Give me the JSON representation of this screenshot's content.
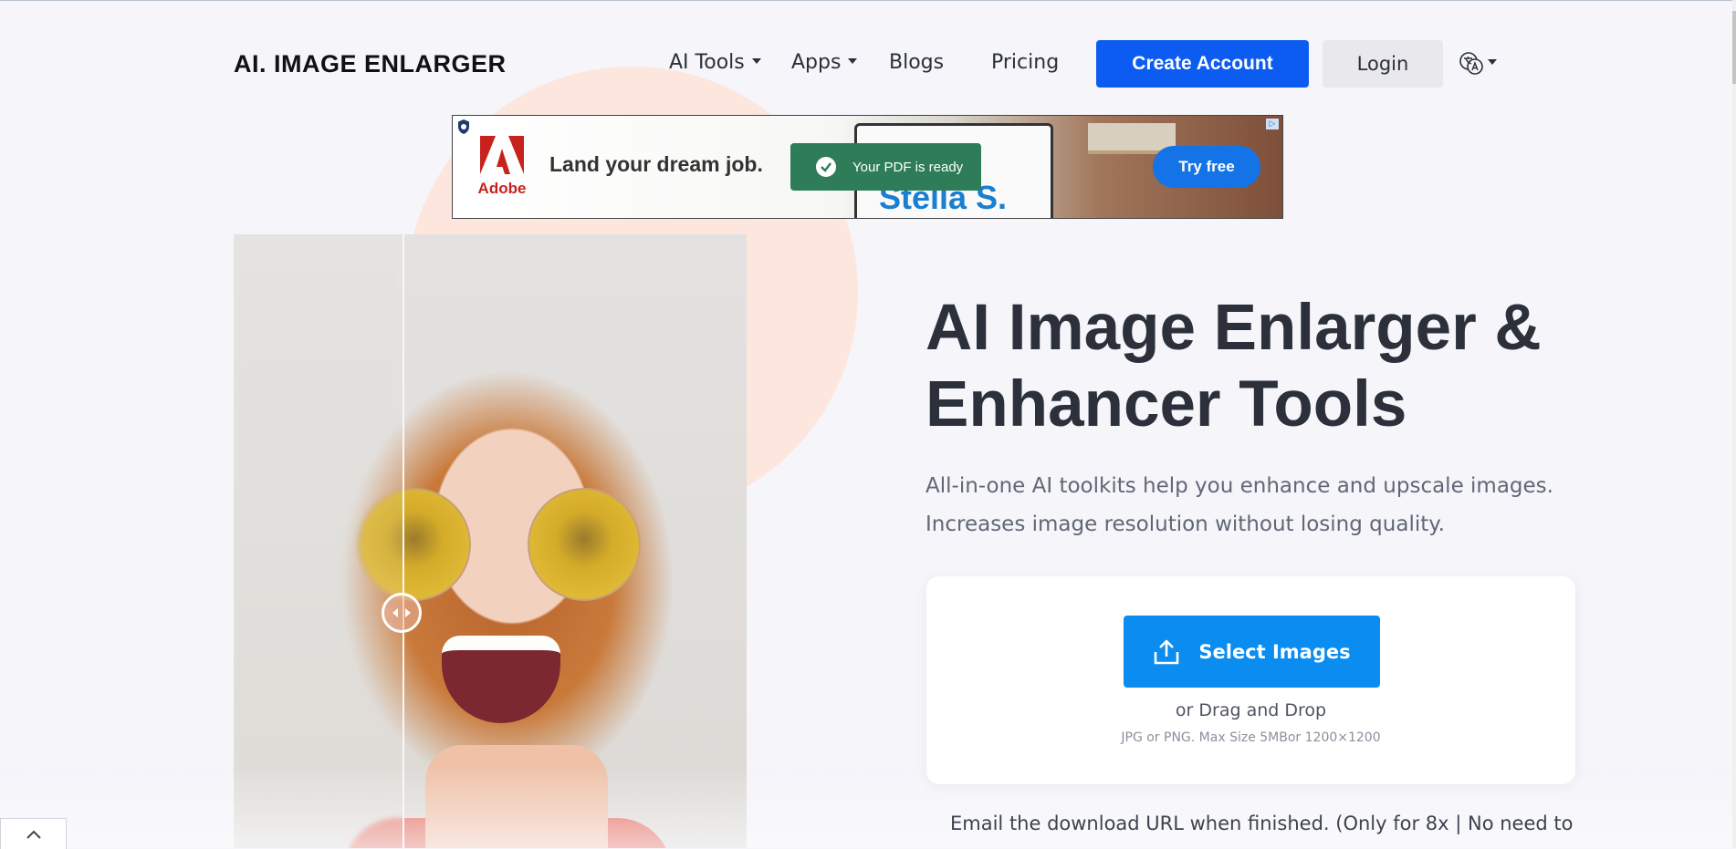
{
  "header": {
    "logo": "AI. IMAGE ENLARGER",
    "nav": [
      {
        "label": "AI Tools"
      },
      {
        "label": "Apps"
      },
      {
        "label": "Blogs"
      },
      {
        "label": "Pricing"
      }
    ],
    "create_account": "Create Account",
    "login": "Login",
    "language_icon": "globe-translate-icon"
  },
  "ad": {
    "brand": "Adobe",
    "headline": "Land your dream job.",
    "toast": "Your PDF is ready",
    "laptop_text": "Stella S.",
    "cta": "Try free"
  },
  "hero": {
    "title": "AI Image Enlarger & Enhancer Tools",
    "subtitle": "All-in-one AI toolkits help you enhance and upscale images. Increases image resolution without losing quality."
  },
  "upload": {
    "button": "Select Images",
    "drag": "or Drag and Drop",
    "hint": "JPG or PNG. Max Size 5MBor 1200×1200"
  },
  "email_note": "Email the download URL when finished. (Only for 8x | No need to",
  "colors": {
    "primary": "#0d5cf1",
    "upload_button": "#0a8cf0",
    "deco_circle": "#fde6de",
    "text": "#2b303b"
  }
}
